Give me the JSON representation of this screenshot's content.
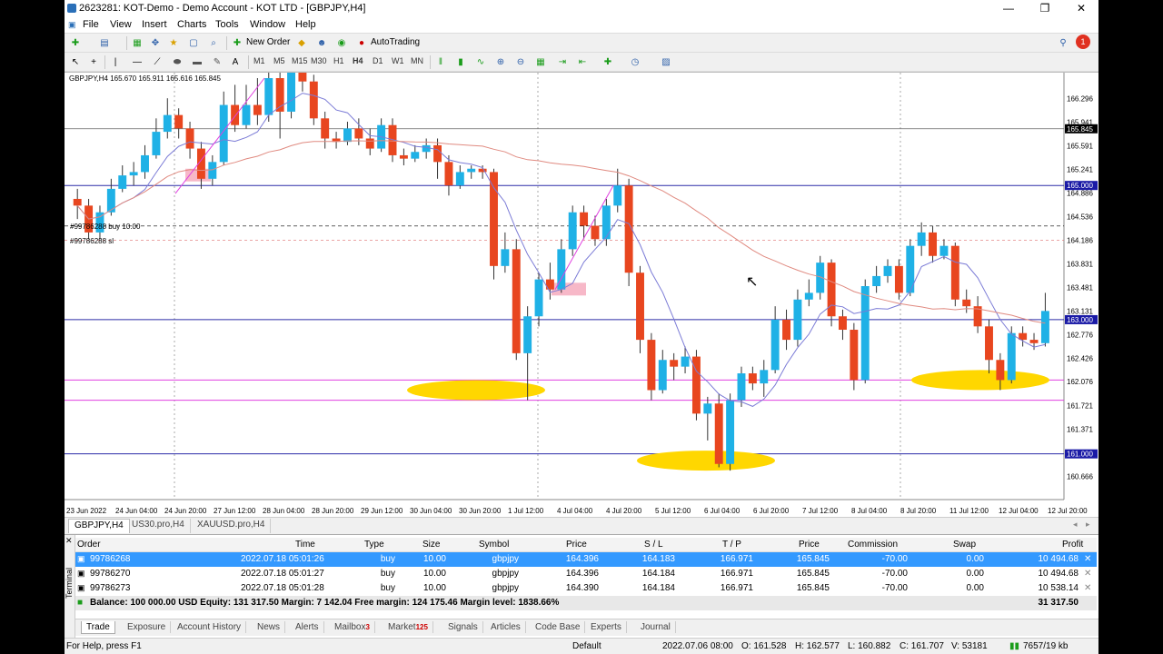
{
  "window": {
    "title": "2623281: KOT-Demo - Demo Account - KOT LTD - [GBPJPY,H4]",
    "min": "—",
    "max": "❐",
    "close": "✕"
  },
  "menu": [
    "File",
    "View",
    "Insert",
    "Charts",
    "Tools",
    "Window",
    "Help"
  ],
  "toolbar1": {
    "new_order": "New Order",
    "autotrading": "AutoTrading",
    "notif_count": "1"
  },
  "timeframes": [
    "M1",
    "M5",
    "M15",
    "M30",
    "H1",
    "H4",
    "D1",
    "W1",
    "MN"
  ],
  "chart": {
    "symbol_line": "GBPJPY,H4  165.670 165.911 165.616 165.845",
    "note_buy": "#99786288 buy 10.00",
    "note_sl": "#99786288 sl",
    "price_labels": [
      "166.296",
      "165.941",
      "165.591",
      "165.241",
      "164.886",
      "164.536",
      "164.186",
      "163.831",
      "163.481",
      "163.131",
      "162.776",
      "162.426",
      "162.076",
      "161.721",
      "161.371",
      "161.016",
      "160.666"
    ],
    "highlight_labels": [
      {
        "text": "165.845",
        "bg": "#000000"
      },
      {
        "text": "165.000",
        "bg": "#1a1aa6"
      },
      {
        "text": "163.000",
        "bg": "#1a1aa6"
      },
      {
        "text": "161.000",
        "bg": "#1a1aa6"
      }
    ],
    "time_labels": [
      "23 Jun 2022",
      "24 Jun 04:00",
      "24 Jun 20:00",
      "27 Jun 12:00",
      "28 Jun 04:00",
      "28 Jun 20:00",
      "29 Jun 12:00",
      "30 Jun 04:00",
      "30 Jun 20:00",
      "1 Jul 12:00",
      "4 Jul 04:00",
      "4 Jul 20:00",
      "5 Jul 12:00",
      "6 Jul 04:00",
      "6 Jul 20:00",
      "7 Jul 12:00",
      "8 Jul 04:00",
      "8 Jul 20:00",
      "11 Jul 12:00",
      "12 Jul 04:00",
      "12 Jul 20:00"
    ],
    "candles": [
      [
        164.8,
        164.7,
        164.95,
        164.5
      ],
      [
        164.7,
        164.3,
        164.8,
        164.2
      ],
      [
        164.3,
        164.6,
        164.7,
        164.2
      ],
      [
        164.6,
        164.95,
        165.1,
        164.55
      ],
      [
        164.95,
        165.15,
        165.3,
        164.9
      ],
      [
        165.15,
        165.2,
        165.35,
        165.0
      ],
      [
        165.2,
        165.45,
        165.6,
        165.1
      ],
      [
        165.45,
        165.8,
        166.0,
        165.4
      ],
      [
        165.8,
        166.05,
        166.3,
        165.7
      ],
      [
        166.05,
        165.85,
        166.15,
        165.7
      ],
      [
        165.85,
        165.55,
        165.95,
        165.4
      ],
      [
        165.55,
        165.1,
        165.65,
        164.95
      ],
      [
        165.1,
        165.35,
        165.45,
        165.0
      ],
      [
        165.35,
        166.2,
        166.4,
        165.3
      ],
      [
        166.2,
        165.9,
        166.5,
        165.8
      ],
      [
        165.9,
        166.2,
        166.5,
        165.85
      ],
      [
        166.2,
        166.05,
        166.6,
        165.9
      ],
      [
        166.05,
        166.6,
        166.8,
        165.95
      ],
      [
        166.6,
        166.1,
        166.7,
        165.7
      ],
      [
        166.1,
        166.75,
        166.9,
        166.0
      ],
      [
        166.75,
        166.55,
        166.9,
        166.4
      ],
      [
        166.55,
        166.0,
        166.65,
        165.9
      ],
      [
        166.0,
        165.7,
        166.1,
        165.55
      ],
      [
        165.7,
        165.65,
        165.8,
        165.55
      ],
      [
        165.65,
        165.85,
        165.95,
        165.6
      ],
      [
        165.85,
        165.7,
        166.0,
        165.6
      ],
      [
        165.7,
        165.55,
        165.85,
        165.45
      ],
      [
        165.55,
        165.9,
        166.0,
        165.5
      ],
      [
        165.9,
        165.45,
        166.0,
        165.35
      ],
      [
        165.45,
        165.4,
        165.55,
        165.3
      ],
      [
        165.4,
        165.5,
        165.6,
        165.35
      ],
      [
        165.5,
        165.6,
        165.7,
        165.4
      ],
      [
        165.6,
        165.35,
        165.7,
        165.1
      ],
      [
        165.35,
        165.0,
        165.45,
        164.85
      ],
      [
        165.0,
        165.2,
        165.3,
        164.95
      ],
      [
        165.2,
        165.25,
        165.3,
        165.1
      ],
      [
        165.25,
        165.2,
        165.3,
        165.1
      ],
      [
        165.2,
        163.8,
        165.25,
        163.6
      ],
      [
        163.8,
        164.05,
        164.3,
        163.7
      ],
      [
        164.05,
        162.5,
        164.2,
        162.4
      ],
      [
        162.5,
        163.05,
        163.2,
        161.8
      ],
      [
        163.05,
        163.6,
        163.7,
        162.9
      ],
      [
        163.6,
        163.45,
        163.85,
        163.3
      ],
      [
        163.45,
        164.05,
        164.2,
        163.4
      ],
      [
        164.05,
        164.6,
        164.7,
        163.95
      ],
      [
        164.6,
        164.4,
        164.7,
        164.2
      ],
      [
        164.4,
        164.2,
        164.55,
        164.1
      ],
      [
        164.2,
        164.7,
        164.8,
        164.1
      ],
      [
        164.7,
        165.0,
        165.25,
        164.6
      ],
      [
        165.0,
        163.7,
        165.1,
        163.5
      ],
      [
        163.7,
        162.7,
        163.8,
        162.5
      ],
      [
        162.7,
        161.95,
        162.8,
        161.8
      ],
      [
        161.95,
        162.4,
        162.55,
        161.9
      ],
      [
        162.4,
        162.3,
        162.5,
        162.1
      ],
      [
        162.3,
        162.45,
        162.6,
        162.2
      ],
      [
        162.45,
        161.6,
        162.55,
        161.5
      ],
      [
        161.6,
        161.75,
        161.85,
        161.2
      ],
      [
        161.75,
        160.85,
        161.9,
        160.8
      ],
      [
        160.85,
        161.8,
        161.9,
        160.75
      ],
      [
        161.8,
        162.2,
        162.3,
        161.7
      ],
      [
        162.2,
        162.05,
        162.3,
        161.95
      ],
      [
        162.05,
        162.25,
        162.4,
        161.85
      ],
      [
        162.25,
        163.0,
        163.2,
        162.2
      ],
      [
        163.0,
        162.7,
        163.15,
        162.55
      ],
      [
        162.7,
        163.3,
        163.45,
        162.6
      ],
      [
        163.3,
        163.4,
        163.6,
        163.2
      ],
      [
        163.4,
        163.85,
        163.95,
        163.3
      ],
      [
        163.85,
        163.05,
        163.9,
        162.9
      ],
      [
        163.05,
        162.85,
        163.15,
        162.7
      ],
      [
        162.85,
        162.1,
        162.95,
        161.95
      ],
      [
        162.1,
        163.5,
        163.6,
        162.05
      ],
      [
        163.5,
        163.65,
        163.8,
        163.4
      ],
      [
        163.65,
        163.8,
        163.9,
        163.55
      ],
      [
        163.8,
        163.4,
        163.9,
        163.3
      ],
      [
        163.4,
        164.1,
        164.2,
        163.35
      ],
      [
        164.1,
        164.3,
        164.45,
        163.95
      ],
      [
        164.3,
        163.95,
        164.4,
        163.85
      ],
      [
        163.95,
        164.1,
        164.2,
        163.9
      ],
      [
        164.1,
        163.3,
        164.15,
        163.2
      ],
      [
        163.3,
        163.2,
        163.45,
        163.1
      ],
      [
        163.2,
        162.9,
        163.35,
        162.8
      ],
      [
        162.9,
        162.4,
        163.0,
        162.2
      ],
      [
        162.4,
        162.1,
        162.5,
        161.95
      ],
      [
        162.1,
        162.8,
        162.9,
        162.05
      ],
      [
        162.8,
        162.7,
        162.9,
        162.6
      ],
      [
        162.7,
        162.65,
        162.8,
        162.55
      ],
      [
        162.65,
        163.13,
        163.4,
        162.6
      ]
    ]
  },
  "chart_tabs": [
    "GBPJPY,H4",
    "US30.pro,H4",
    "XAUUSD.pro,H4"
  ],
  "terminal": {
    "side_label": "Terminal",
    "headers": [
      "Order",
      "Time",
      "Type",
      "Size",
      "Symbol",
      "Price",
      "S / L",
      "T / P",
      "Price",
      "Commission",
      "Swap",
      "Profit"
    ],
    "rows": [
      [
        "99786268",
        "2022.07.18 05:01:26",
        "buy",
        "10.00",
        "gbpjpy",
        "164.396",
        "164.183",
        "166.971",
        "165.845",
        "-70.00",
        "0.00",
        "10 494.68"
      ],
      [
        "99786270",
        "2022.07.18 05:01:27",
        "buy",
        "10.00",
        "gbpjpy",
        "164.396",
        "164.184",
        "166.971",
        "165.845",
        "-70.00",
        "0.00",
        "10 494.68"
      ],
      [
        "99786273",
        "2022.07.18 05:01:28",
        "buy",
        "10.00",
        "gbpjpy",
        "164.390",
        "164.184",
        "166.971",
        "165.845",
        "-70.00",
        "0.00",
        "10 538.14"
      ]
    ],
    "balance_line": "Balance: 100 000.00 USD  Equity: 131 317.50  Margin: 7 142.04  Free margin: 124 175.46  Margin level: 1838.66%",
    "balance_profit": "31 317.50"
  },
  "bottom_tabs": [
    {
      "label": "Trade",
      "badge": ""
    },
    {
      "label": "Exposure",
      "badge": ""
    },
    {
      "label": "Account History",
      "badge": ""
    },
    {
      "label": "News",
      "badge": ""
    },
    {
      "label": "Alerts",
      "badge": ""
    },
    {
      "label": "Mailbox",
      "badge": "3"
    },
    {
      "label": "Market",
      "badge": "125"
    },
    {
      "label": "Signals",
      "badge": ""
    },
    {
      "label": "Articles",
      "badge": ""
    },
    {
      "label": "Code Base",
      "badge": ""
    },
    {
      "label": "Experts",
      "badge": ""
    },
    {
      "label": "Journal",
      "badge": ""
    }
  ],
  "status": {
    "help": "For Help, press F1",
    "profile": "Default",
    "datetime": "2022.07.06 08:00",
    "open": "O: 161.528",
    "high": "H: 162.577",
    "low": "L: 160.882",
    "close": "C: 161.707",
    "volume": "V: 53181",
    "traffic": "7657/19 kb"
  },
  "colors": {
    "bull": "#1fb1e6",
    "bear": "#e8461f",
    "ma_fast": "#7b7bd6",
    "ma_slow": "#e08a80",
    "pink_line": "#e040e0",
    "blue_line": "#2c2ca8",
    "highlight": "#ffd700",
    "selection": "#3399ff"
  }
}
